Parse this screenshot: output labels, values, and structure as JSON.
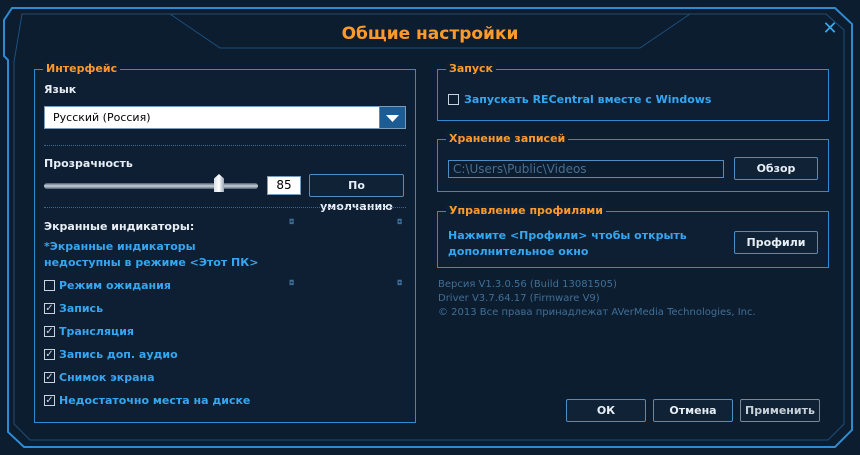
{
  "window": {
    "title": "Общие настройки",
    "close_icon": "close-icon"
  },
  "interface": {
    "legend": "Интерфейс",
    "language_label": "Язык",
    "language_value": "Русский (Россия)",
    "transparency_label": "Прозрачность",
    "transparency_value": "85",
    "transparency_level": 85,
    "default_button": "По умолчанию",
    "indicators_label": "Экранные индикаторы:",
    "indicators_note": "*Экранные индикаторы недоступны в режиме <Этот ПК>",
    "checkboxes": [
      {
        "label": "Режим ожидания",
        "checked": false
      },
      {
        "label": "Запись",
        "checked": true
      },
      {
        "label": "Трансляция",
        "checked": true
      },
      {
        "label": "Запись доп. аудио",
        "checked": true
      },
      {
        "label": "Снимок экрана",
        "checked": true
      },
      {
        "label": "Недостаточно места на диске",
        "checked": true
      }
    ]
  },
  "launch": {
    "legend": "Запуск",
    "checkbox_label": "Запускать RECentral вместе с Windows",
    "checked": false
  },
  "storage": {
    "legend": "Хранение записей",
    "path": "C:\\Users\\Public\\Videos",
    "browse_button": "Обзор"
  },
  "profiles": {
    "legend": "Управление профилями",
    "text": "Нажмите <Профили> чтобы открыть дополнительное окно",
    "button": "Профили"
  },
  "info": {
    "version": "Версия V1.3.0.56 (Build 13081505)",
    "driver": "Driver V3.7.64.17 (Firmware V9)",
    "copyright": "© 2013 Все права принадлежат AVerMedia Technologies, Inc."
  },
  "footer": {
    "ok": "ОК",
    "cancel": "Отмена",
    "apply": "Применить"
  },
  "colors": {
    "accent_orange": "#ff9a2a",
    "accent_blue": "#35a7f0",
    "background": "#0d1d30"
  }
}
